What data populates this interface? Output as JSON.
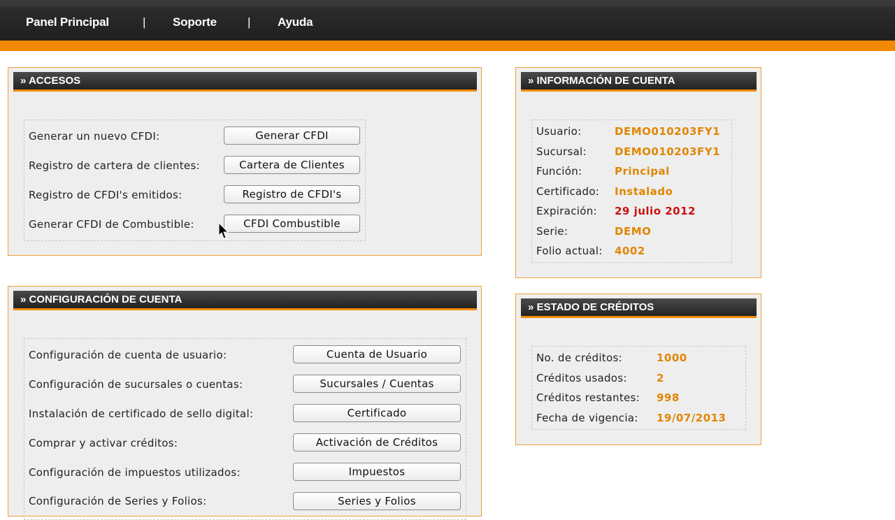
{
  "nav": {
    "items": [
      "Panel Principal",
      "Soporte",
      "Ayuda"
    ],
    "separator": "|"
  },
  "colors": {
    "accent": "#f18a00",
    "value_orange": "#e08600",
    "value_red": "#cc1111"
  },
  "accesos": {
    "title": "» ACCESOS",
    "rows": [
      {
        "label": "Generar un nuevo CFDI:",
        "button": "Generar CFDI"
      },
      {
        "label": "Registro de cartera de clientes:",
        "button": "Cartera de Clientes"
      },
      {
        "label": "Registro de CFDI's emitidos:",
        "button": "Registro de CFDI's"
      },
      {
        "label": "Generar CFDI de Combustible:",
        "button": "CFDI Combustible"
      }
    ]
  },
  "configuracion": {
    "title": "» CONFIGURACIÓN DE CUENTA",
    "rows": [
      {
        "label": "Configuración de cuenta de usuario:",
        "button": "Cuenta de Usuario"
      },
      {
        "label": "Configuración de sucursales o cuentas:",
        "button": "Sucursales / Cuentas"
      },
      {
        "label": "Instalación de certificado de sello digital:",
        "button": "Certificado"
      },
      {
        "label": "Comprar y activar créditos:",
        "button": "Activación de Créditos"
      },
      {
        "label": "Configuración de impuestos utilizados:",
        "button": "Impuestos"
      },
      {
        "label": "Configuración de Series y Folios:",
        "button": "Series y Folios"
      }
    ]
  },
  "informacion": {
    "title": "» INFORMACIÓN DE CUENTA",
    "rows": [
      {
        "label": "Usuario:",
        "value": "DEMO010203FY1",
        "status": "normal"
      },
      {
        "label": "Sucursal:",
        "value": "DEMO010203FY1",
        "status": "normal"
      },
      {
        "label": "Función:",
        "value": "Principal",
        "status": "normal"
      },
      {
        "label": "Certificado:",
        "value": "Instalado",
        "status": "normal"
      },
      {
        "label": "Expiración:",
        "value": "29 julio 2012",
        "status": "alert"
      },
      {
        "label": "Serie:",
        "value": "DEMO",
        "status": "normal"
      },
      {
        "label": "Folio actual:",
        "value": "4002",
        "status": "normal"
      }
    ]
  },
  "creditos": {
    "title": "» ESTADO DE CRÉDITOS",
    "rows": [
      {
        "label": "No. de créditos:",
        "value": "1000"
      },
      {
        "label": "Créditos usados:",
        "value": "2"
      },
      {
        "label": "Créditos restantes:",
        "value": "998"
      },
      {
        "label": "Fecha de vigencia:",
        "value": "19/07/2013"
      }
    ]
  }
}
